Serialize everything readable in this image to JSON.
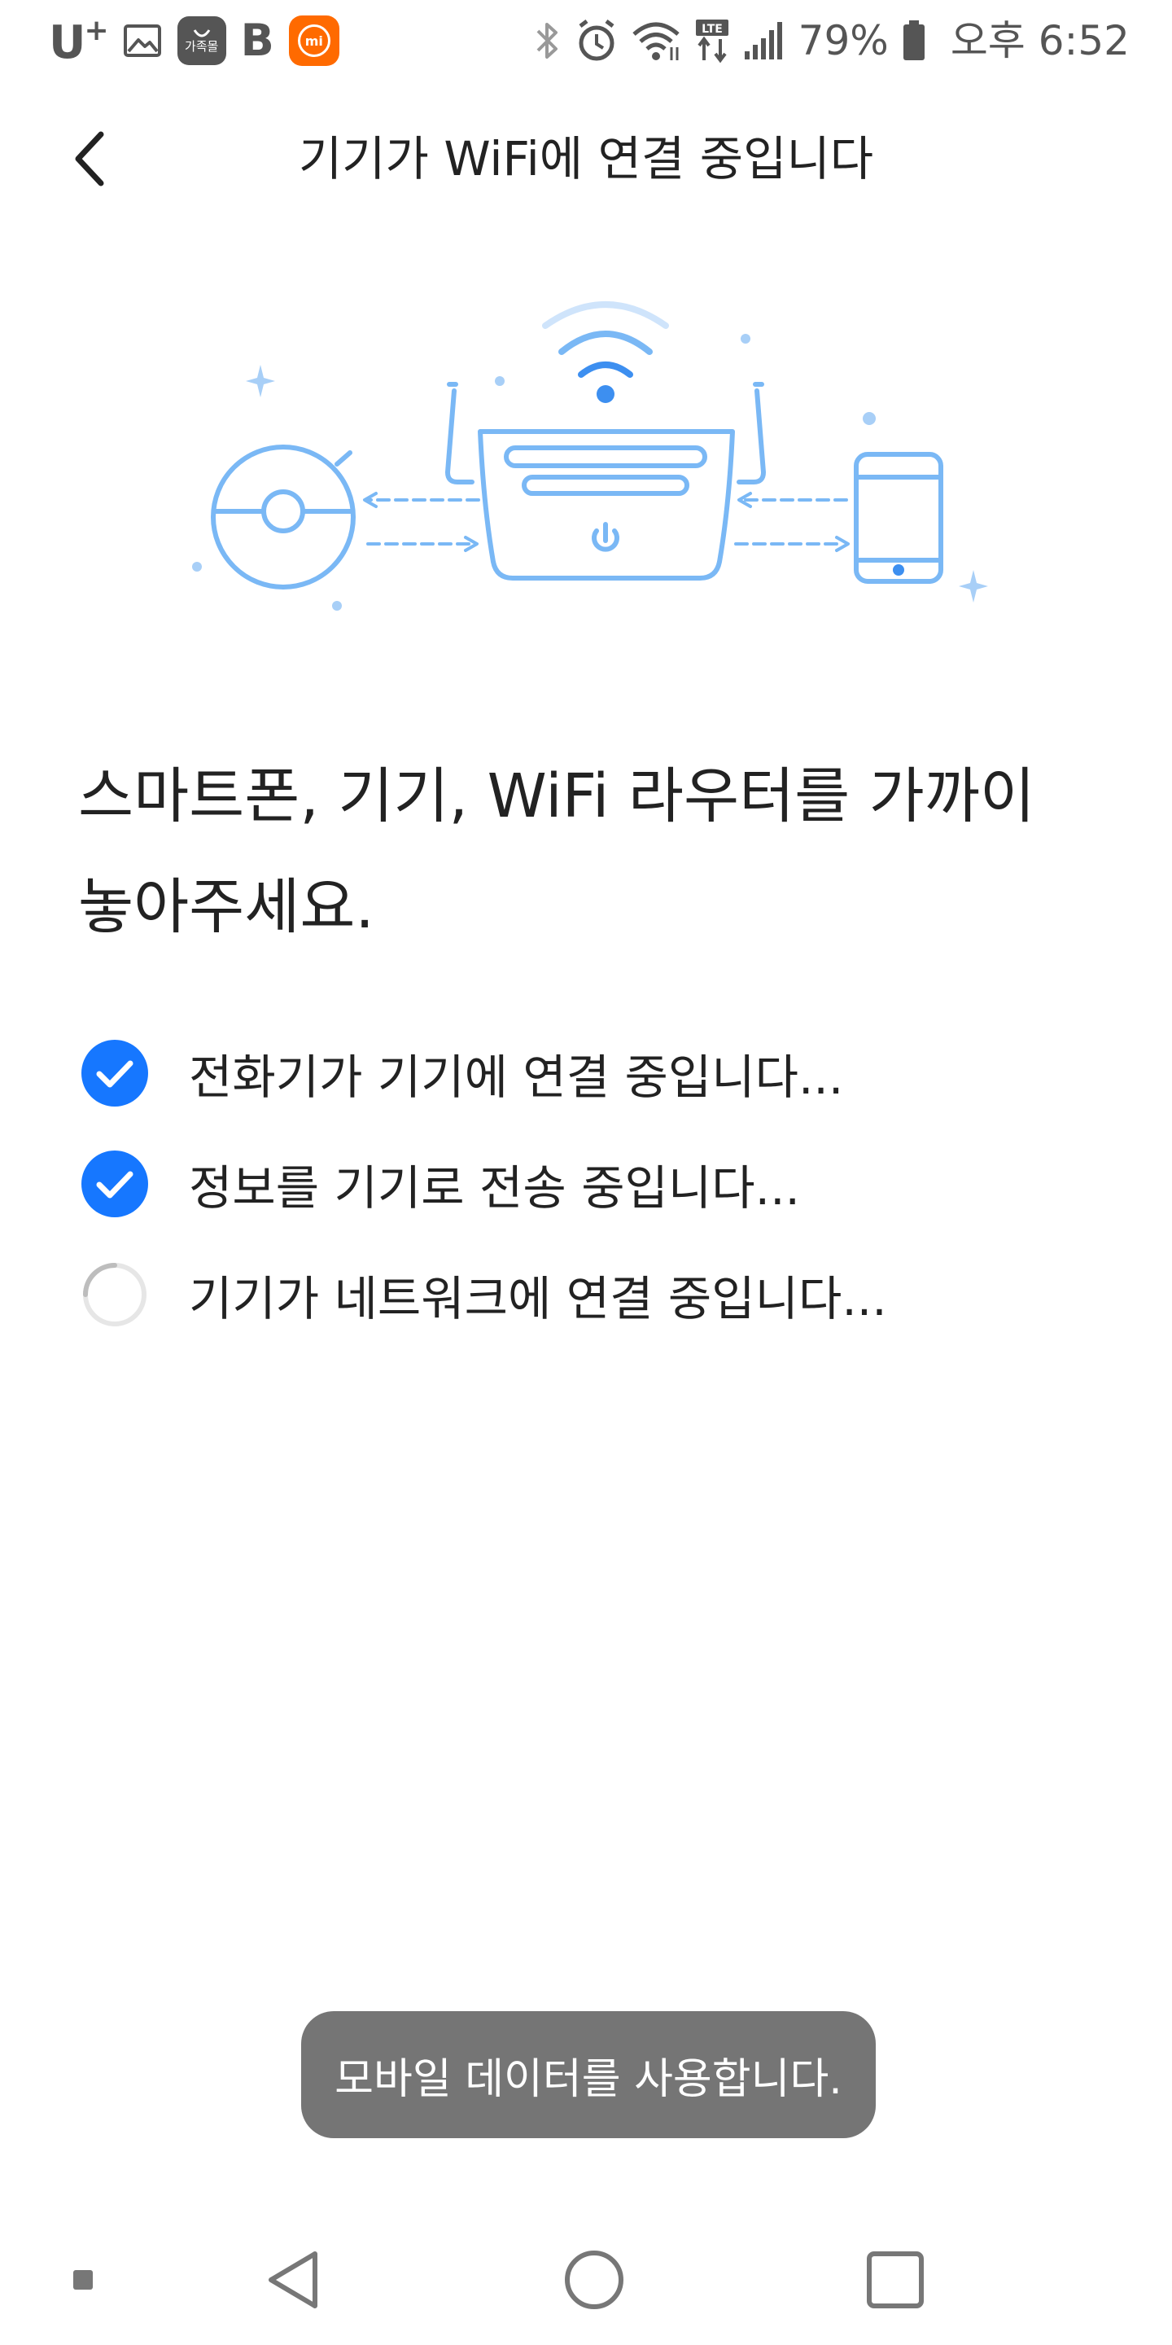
{
  "status_bar": {
    "carrier": "U",
    "carrier_plus": "+",
    "shop_badge_text": "가족몰",
    "b_letter": "B",
    "mi_text": "mi",
    "battery": "79%",
    "time": "오후 6:52"
  },
  "header": {
    "title": "기기가 WiFi에 연결 중입니다"
  },
  "instruction": {
    "line1": "스마트폰, 기기, WiFi 라우터를 가까이",
    "line2": "놓아주세요."
  },
  "steps": [
    {
      "label": "전화기가 기기에 연결 중입니다...",
      "status": "done"
    },
    {
      "label": "정보를 기기로 전송 중입니다...",
      "status": "done"
    },
    {
      "label": "기기가 네트워크에 연결 중입니다...",
      "status": "in-progress"
    }
  ],
  "toast": {
    "message": "모바일 데이터를 사용합니다."
  },
  "colors": {
    "accent": "#1677ff",
    "illustration": "#7ab8f5",
    "illustration_light": "#cfe4fb",
    "toast_bg": "#757575",
    "icon_gray": "#555555"
  }
}
